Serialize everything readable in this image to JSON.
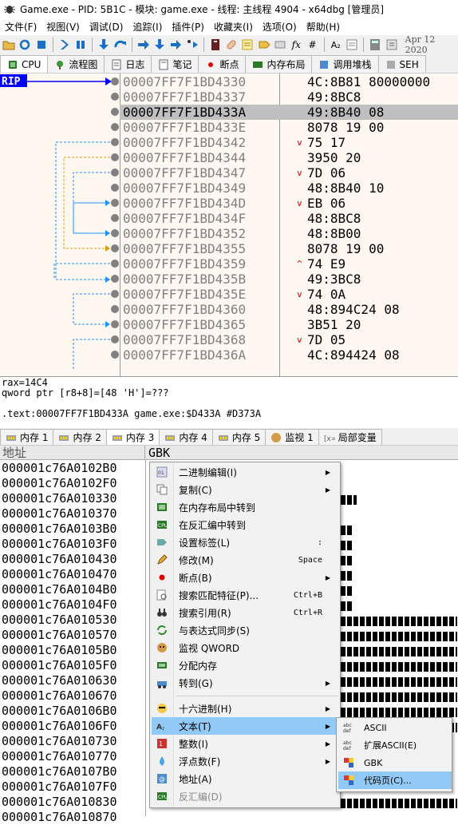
{
  "window": {
    "title": "Game.exe - PID: 5B1C - 模块: game.exe - 线程: 主线程 4904 - x64dbg [管理员]"
  },
  "menu": {
    "items": [
      "文件(F)",
      "视图(V)",
      "调试(D)",
      "追踪(I)",
      "插件(P)",
      "收藏夹(I)",
      "选项(O)",
      "帮助(H)"
    ],
    "date": "Apr 12 2020"
  },
  "toolbar": {
    "icons": [
      "open-icon",
      "restart-icon",
      "stop-icon",
      "run-icon",
      "pause-icon",
      "step-into-icon",
      "step-over-icon",
      "trace-into-icon",
      "trace-over-icon",
      "run-to-user-icon",
      "animate-icon",
      "script-icon",
      "patch-icon",
      "comment-icon",
      "label-icon",
      "bookmark-icon",
      "function-icon",
      "font-icon",
      "calculator-icon",
      "help-icon"
    ],
    "fx": "fx",
    "hash": "#",
    "az": "A₂"
  },
  "top_tabs": [
    {
      "label": "CPU",
      "icon": "cpu-icon",
      "active": true
    },
    {
      "label": "流程图",
      "icon": "graph-icon",
      "active": false
    },
    {
      "label": "日志",
      "icon": "log-icon",
      "active": false
    },
    {
      "label": "笔记",
      "icon": "notes-icon",
      "active": false
    },
    {
      "label": "断点",
      "icon": "breakpoint-icon",
      "active": false
    },
    {
      "label": "内存布局",
      "icon": "memory-map-icon",
      "active": false
    },
    {
      "label": "调用堆栈",
      "icon": "call-stack-icon",
      "active": false
    },
    {
      "label": "SEH",
      "icon": "seh-icon",
      "active": false
    }
  ],
  "disasm": {
    "rip_label": "RIP",
    "rows": [
      {
        "addr": "00007FF7F1BD4330",
        "mark": "",
        "bytes": "4C:8B81 80000000"
      },
      {
        "addr": "00007FF7F1BD4337",
        "mark": "",
        "bytes": "49:8BC8"
      },
      {
        "addr": "00007FF7F1BD433A",
        "mark": "",
        "bytes": "49:8B40 08"
      },
      {
        "addr": "00007FF7F1BD433E",
        "mark": "",
        "bytes": "8078 19 00"
      },
      {
        "addr": "00007FF7F1BD4342",
        "mark": "v",
        "bytes": "75 17"
      },
      {
        "addr": "00007FF7F1BD4344",
        "mark": "",
        "bytes": "3950 20"
      },
      {
        "addr": "00007FF7F1BD4347",
        "mark": "v",
        "bytes": "7D 06"
      },
      {
        "addr": "00007FF7F1BD4349",
        "mark": "",
        "bytes": "48:8B40 10"
      },
      {
        "addr": "00007FF7F1BD434D",
        "mark": "v",
        "bytes": "EB 06"
      },
      {
        "addr": "00007FF7F1BD434F",
        "mark": "",
        "bytes": "48:8BC8"
      },
      {
        "addr": "00007FF7F1BD4352",
        "mark": "",
        "bytes": "48:8B00"
      },
      {
        "addr": "00007FF7F1BD4355",
        "mark": "",
        "bytes": "8078 19 00"
      },
      {
        "addr": "00007FF7F1BD4359",
        "mark": "^",
        "bytes": "74 E9"
      },
      {
        "addr": "00007FF7F1BD435B",
        "mark": "",
        "bytes": "49:3BC8"
      },
      {
        "addr": "00007FF7F1BD435E",
        "mark": "v",
        "bytes": "74 0A"
      },
      {
        "addr": "00007FF7F1BD4360",
        "mark": "",
        "bytes": "48:894C24 08"
      },
      {
        "addr": "00007FF7F1BD4365",
        "mark": "",
        "bytes": "3B51 20"
      },
      {
        "addr": "00007FF7F1BD4368",
        "mark": "v",
        "bytes": "7D 05"
      },
      {
        "addr": "00007FF7F1BD436A",
        "mark": "",
        "bytes": "4C:894424 08"
      }
    ],
    "selected_index": 2
  },
  "info": {
    "line1": "rax=14C4",
    "line2": "qword ptr [r8+8]=[48 'H']=???",
    "line3": "",
    "line4": ".text:00007FF7F1BD433A game.exe:$D433A #D373A"
  },
  "bottom_tabs": [
    {
      "label": "内存 1",
      "icon": "memory-icon"
    },
    {
      "label": "内存 2",
      "icon": "memory-icon"
    },
    {
      "label": "内存 3",
      "icon": "memory-icon",
      "active": true
    },
    {
      "label": "内存 4",
      "icon": "memory-icon"
    },
    {
      "label": "内存 5",
      "icon": "memory-icon"
    },
    {
      "label": "监视 1",
      "icon": "watch-icon"
    },
    {
      "label": "局部变量",
      "icon": "locals-icon"
    }
  ],
  "dump": {
    "col_address": "地址",
    "col_text": "GBK",
    "rows": [
      "000001c76A0102B0",
      "000001c76A0102F0",
      "000001c76A010330",
      "000001c76A010370",
      "000001c76A0103B0",
      "000001c76A0103F0",
      "000001c76A010430",
      "000001c76A010470",
      "000001c76A0104B0",
      "000001c76A0104F0",
      "000001c76A010530",
      "000001c76A010570",
      "000001c76A0105B0",
      "000001c76A0105F0",
      "000001c76A010630",
      "000001c76A010670",
      "000001c76A0106B0",
      "000001c76A0106F0",
      "000001c76A010730",
      "000001c76A010770",
      "000001c76A0107B0",
      "000001c76A0107F0",
      "000001c76A010830",
      "000001c76A010870"
    ]
  },
  "context_menu": [
    {
      "label": "二进制编辑(I)",
      "icon": "binary-icon",
      "shortcut": "",
      "submenu": true
    },
    {
      "label": "复制(C)",
      "icon": "copy-icon",
      "shortcut": "",
      "submenu": true
    },
    {
      "label": "在内存布局中转到",
      "icon": "memory-map-icon",
      "shortcut": "",
      "submenu": false
    },
    {
      "label": "在反汇编中转到",
      "icon": "disasm-icon",
      "shortcut": "",
      "submenu": false
    },
    {
      "label": "设置标签(L)",
      "icon": "label-icon",
      "shortcut": ":",
      "submenu": false
    },
    {
      "label": "修改(M)",
      "icon": "pencil-icon",
      "shortcut": "Space",
      "submenu": false
    },
    {
      "label": "断点(B)",
      "icon": "breakpoint-icon",
      "shortcut": "",
      "submenu": true
    },
    {
      "label": "搜索匹配特征(P)...",
      "icon": "search-pattern-icon",
      "shortcut": "Ctrl+B",
      "submenu": false
    },
    {
      "label": "搜索引用(R)",
      "icon": "binoculars-icon",
      "shortcut": "Ctrl+R",
      "submenu": false
    },
    {
      "label": "与表达式同步(S)",
      "icon": "sync-icon",
      "shortcut": "",
      "submenu": false
    },
    {
      "label": "监视 QWORD",
      "icon": "watch-icon",
      "shortcut": "",
      "submenu": false
    },
    {
      "label": "分配内存",
      "icon": "alloc-icon",
      "shortcut": "",
      "submenu": false
    },
    {
      "label": "转到(G)",
      "icon": "goto-icon",
      "shortcut": "",
      "submenu": true
    },
    {
      "label": "十六进制(H)",
      "icon": "hex-icon",
      "shortcut": "",
      "submenu": true
    },
    {
      "label": "文本(T)",
      "icon": "text-icon",
      "shortcut": "",
      "submenu": true
    },
    {
      "label": "整数(I)",
      "icon": "integer-icon",
      "shortcut": "",
      "submenu": true
    },
    {
      "label": "浮点数(F)",
      "icon": "float-icon",
      "shortcut": "",
      "submenu": true
    },
    {
      "label": "地址(A)",
      "icon": "address-icon",
      "shortcut": "",
      "submenu": false
    },
    {
      "label": "反汇编(D)",
      "icon": "disasm-icon",
      "shortcut": "",
      "submenu": false
    }
  ],
  "submenu": [
    {
      "label": "ASCII",
      "icon": "ascii-icon"
    },
    {
      "label": "扩展ASCII(E)",
      "icon": "ext-ascii-icon"
    },
    {
      "label": "GBK",
      "icon": "gbk-icon"
    },
    {
      "label": "代码页(C)...",
      "icon": "codepage-icon"
    }
  ],
  "colors": {
    "highlight": "#91c9f7",
    "rip_bg": "#0000ff",
    "selected_row": "#c0c0c0",
    "disasm_bg": "#fff8f0"
  }
}
